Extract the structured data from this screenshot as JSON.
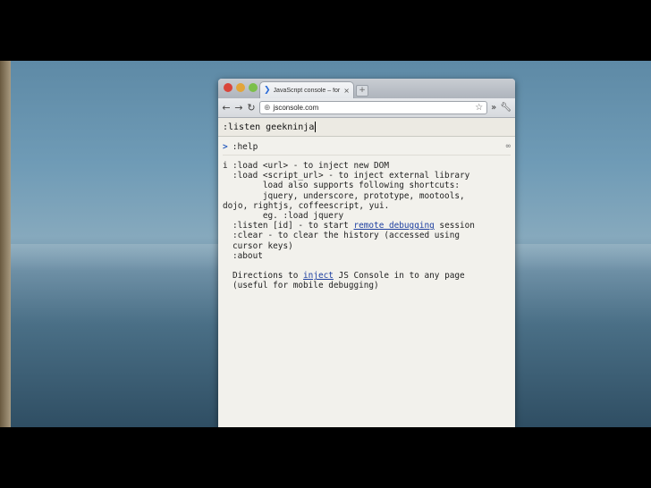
{
  "browser": {
    "tab_title": "JavaScript console – for deb",
    "tab_close": "×",
    "new_tab": "+",
    "url": "jsconsole.com",
    "icons": {
      "back": "back-arrow-icon",
      "forward": "forward-arrow-icon",
      "reload": "reload-icon",
      "globe": "globe-icon",
      "star": "star-icon",
      "extensions": "chevron-double-right-icon",
      "wrench": "wrench-icon"
    }
  },
  "console": {
    "input_value": ":listen geekninja",
    "history_command": ":help",
    "prompt_symbol": ">",
    "info_symbol": "i",
    "help_lines": [
      ":load <url> - to inject new DOM",
      ":load <script_url> - to inject external library",
      "      load also supports following shortcuts:",
      "      jquery, underscore, prototype, mootools,",
      "dojo, rightjs, coffeescript, yui.",
      "      eg. :load jquery",
      ":listen [id] - to start ",
      "remote debugging",
      " session",
      ":clear - to clear the history (accessed using",
      "cursor keys)",
      ":about",
      "",
      "Directions to ",
      "inject",
      " JS Console in to any page",
      "(useful for mobile debugging)"
    ]
  }
}
